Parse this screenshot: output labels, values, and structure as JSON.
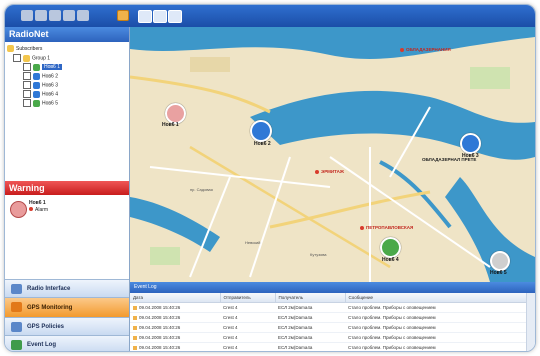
{
  "colors": {
    "accent": "#2d63bd",
    "warning": "#c81d1d",
    "active_nav": "#f39a2e",
    "water": "#3d97c9"
  },
  "app": {
    "title": "RadioNet"
  },
  "toolbar": {
    "icons": [
      "back-icon",
      "forward-icon",
      "home-icon",
      "settings-icon",
      "help-icon",
      "folder-icon",
      "window-icon",
      "window-icon",
      "window-icon"
    ]
  },
  "tree": {
    "root": "Subscribers",
    "group": "Group 1",
    "items": [
      "Нов6 1",
      "Нов6 2",
      "Нов6 3",
      "Нов6 4",
      "Нов6 5"
    ]
  },
  "warning": {
    "title": "Warning",
    "unit": "Нов6 1",
    "message": "Alarm"
  },
  "nav": [
    {
      "label": "Radio Interface",
      "active": false,
      "icon": "radio-icon"
    },
    {
      "label": "GPS Monitoring",
      "active": true,
      "icon": "gps-icon"
    },
    {
      "label": "GPS Policies",
      "active": false,
      "icon": "policy-icon"
    },
    {
      "label": "Event Log",
      "active": false,
      "icon": "log-icon"
    }
  ],
  "map": {
    "units": [
      {
        "label": "Нов6 1",
        "icon": "alarm-unit-icon"
      },
      {
        "label": "Нов6 2",
        "icon": "vehicle-icon"
      },
      {
        "label": "Нов6 3",
        "icon": "vehicle-icon"
      },
      {
        "label": "Нов6 4",
        "icon": "vehicle-icon"
      },
      {
        "label": "Нов6 5",
        "icon": "vehicle-icon"
      }
    ],
    "pois": [
      "ОБЛАДАЗЕРНАНИЯ",
      "ЭРМИТАЖ",
      "ПЕТРОПАВЛОВСКАЯ",
      "ОБЛАДАЗЕРНАЛ ПРЕТЕ"
    ],
    "streets": [
      "Невский",
      "Кутузова",
      "пр. Садовая"
    ]
  },
  "event_log": {
    "title": "Event Log",
    "columns": [
      "Дата",
      "Отправитель",
      "Получатель",
      "Сообщение"
    ],
    "rows": [
      {
        "date": "09.04.2008 15:40:26",
        "from": "Crest 4",
        "to": "ЕСЛ 2м(Dama4a",
        "msg": "Стало проблем. Приборы с оповещением"
      },
      {
        "date": "09.04.2008 15:40:26",
        "from": "Crest 4",
        "to": "ЕСЛ 2м(Dama4a",
        "msg": "Стало проблем. Приборы с оповещением"
      },
      {
        "date": "09.04.2008 15:40:26",
        "from": "Crest 4",
        "to": "ЕСЛ 2м(Dama4a",
        "msg": "Стало проблем. Приборы с оповещением"
      },
      {
        "date": "09.04.2008 15:40:26",
        "from": "Crest 4",
        "to": "ЕСЛ 2м(Dama4a",
        "msg": "Стало проблем. Приборы с оповещением"
      },
      {
        "date": "09.04.2008 15:40:26",
        "from": "Crest 4",
        "to": "ЕСЛ 2м(Dama4a",
        "msg": "Стало проблем. Приборы с оповещением"
      }
    ]
  }
}
